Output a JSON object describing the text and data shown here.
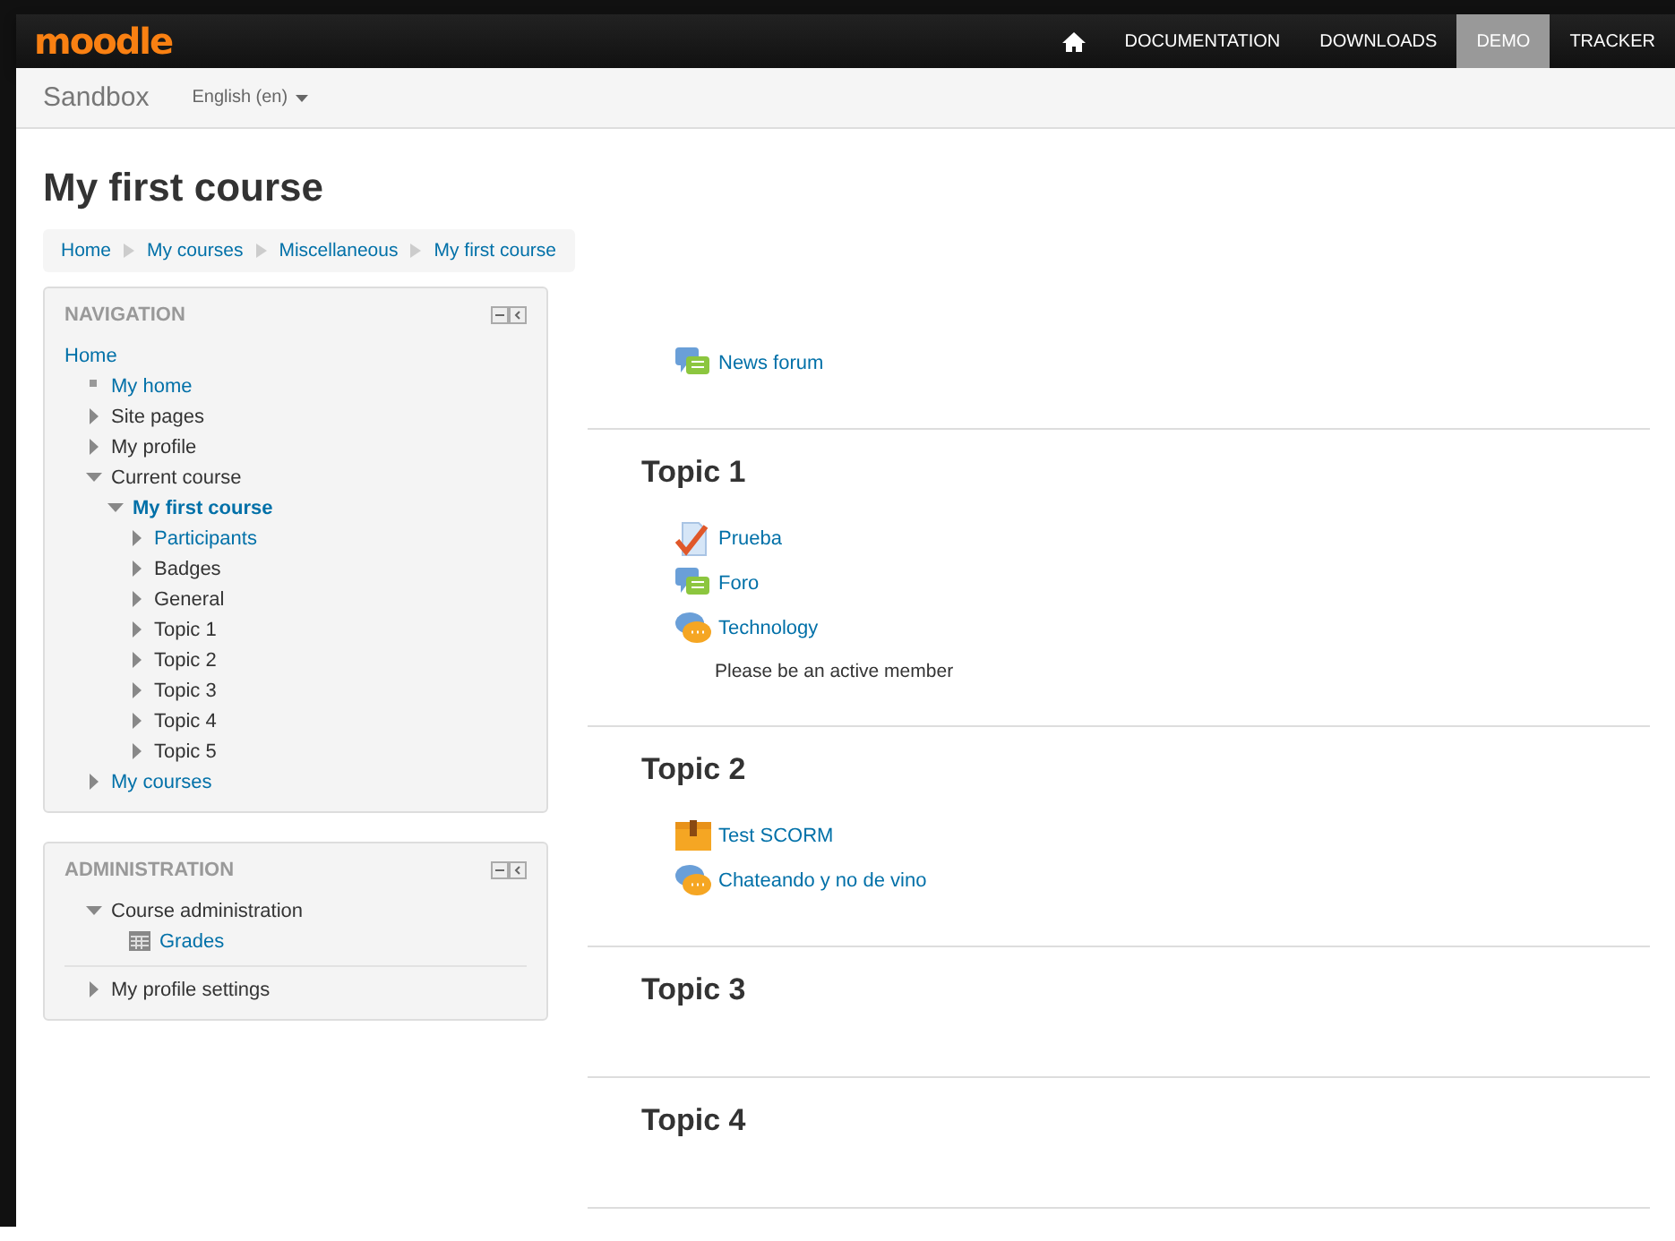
{
  "navbar": {
    "logo": "moodle",
    "items": [
      {
        "kind": "home",
        "selected": false
      },
      {
        "kind": "text",
        "label": "DOCUMENTATION",
        "selected": false
      },
      {
        "kind": "text",
        "label": "DOWNLOADS",
        "selected": false
      },
      {
        "kind": "text",
        "label": "DEMO",
        "selected": true
      },
      {
        "kind": "text",
        "label": "TRACKER",
        "selected": false
      }
    ]
  },
  "subbar": {
    "site": "Sandbox",
    "language": "English (en)"
  },
  "page_title": "My first course",
  "breadcrumb": [
    "Home",
    "My courses",
    "Miscellaneous",
    "My first course"
  ],
  "navigation": {
    "title": "NAVIGATION",
    "items": [
      {
        "label": "Home",
        "kind": "root",
        "link": true
      },
      {
        "label": "My home",
        "kind": "leaf",
        "link": true
      },
      {
        "label": "Site pages",
        "kind": "branch",
        "expanded": false,
        "link": false
      },
      {
        "label": "My profile",
        "kind": "branch",
        "expanded": false,
        "link": false
      },
      {
        "label": "Current course",
        "kind": "branch",
        "expanded": true,
        "link": false,
        "children": [
          {
            "label": "My first course",
            "kind": "branch",
            "expanded": true,
            "link": true,
            "current": true,
            "children": [
              {
                "label": "Participants",
                "kind": "branch",
                "expanded": false,
                "link": true
              },
              {
                "label": "Badges",
                "kind": "branch",
                "expanded": false,
                "link": false
              },
              {
                "label": "General",
                "kind": "branch",
                "expanded": false,
                "link": false
              },
              {
                "label": "Topic 1",
                "kind": "branch",
                "expanded": false,
                "link": false
              },
              {
                "label": "Topic 2",
                "kind": "branch",
                "expanded": false,
                "link": false
              },
              {
                "label": "Topic 3",
                "kind": "branch",
                "expanded": false,
                "link": false
              },
              {
                "label": "Topic 4",
                "kind": "branch",
                "expanded": false,
                "link": false
              },
              {
                "label": "Topic 5",
                "kind": "branch",
                "expanded": false,
                "link": false
              }
            ]
          }
        ]
      },
      {
        "label": "My courses",
        "kind": "branch",
        "expanded": false,
        "link": true
      }
    ]
  },
  "administration": {
    "title": "ADMINISTRATION",
    "items": [
      {
        "label": "Course administration",
        "kind": "branch",
        "expanded": true,
        "link": false,
        "children": [
          {
            "label": "Grades",
            "kind": "grades",
            "link": true
          }
        ]
      },
      {
        "label": "My profile settings",
        "kind": "branch",
        "expanded": false,
        "link": false,
        "divider": true
      }
    ]
  },
  "sections": [
    {
      "activities": [
        {
          "kind": "forum",
          "name": "News forum"
        }
      ]
    },
    {
      "title": "Topic 1",
      "activities": [
        {
          "kind": "quiz",
          "name": "Prueba"
        },
        {
          "kind": "forum",
          "name": "Foro"
        },
        {
          "kind": "chat",
          "name": "Technology",
          "description": "Please be an active member"
        }
      ]
    },
    {
      "title": "Topic 2",
      "activities": [
        {
          "kind": "scorm",
          "name": "Test SCORM"
        },
        {
          "kind": "chat",
          "name": "Chateando y no de vino"
        }
      ]
    },
    {
      "title": "Topic 3"
    },
    {
      "title": "Topic 4"
    }
  ]
}
